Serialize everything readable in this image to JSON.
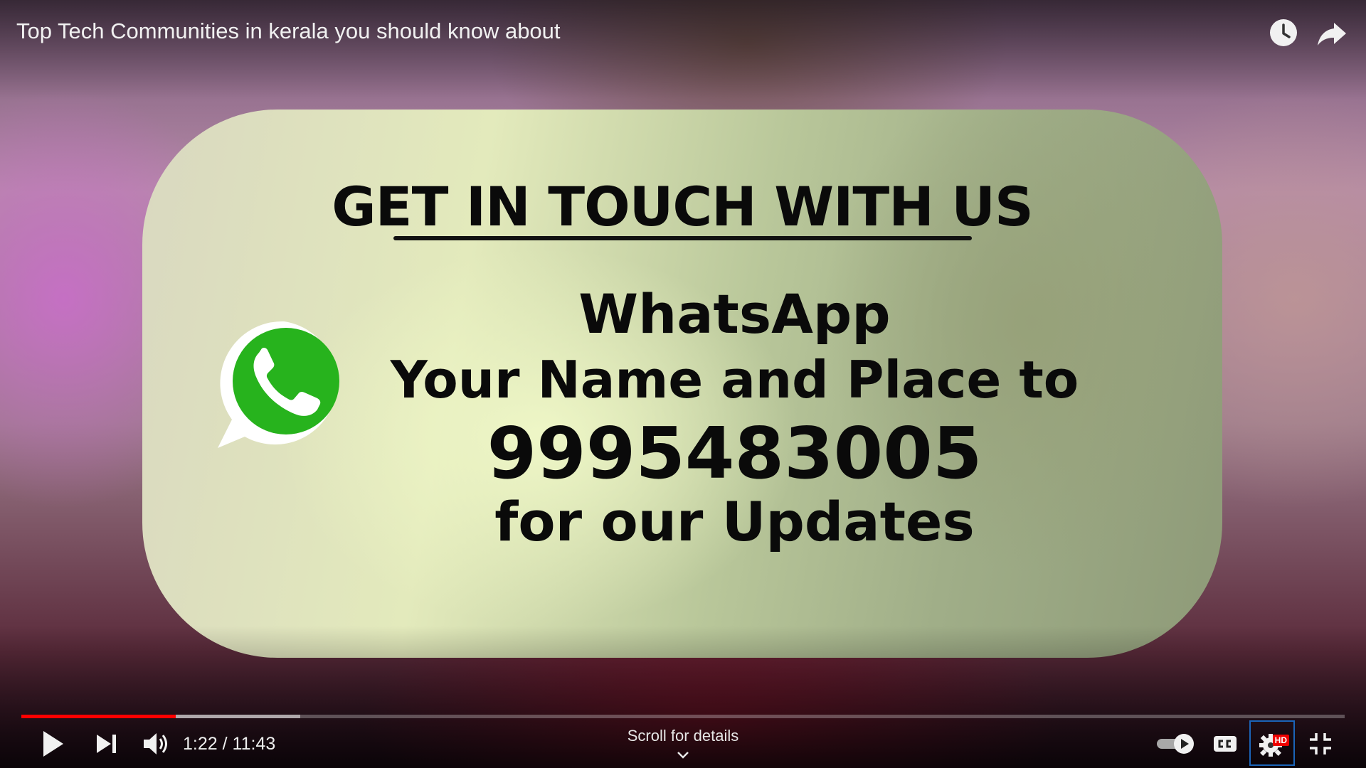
{
  "player": {
    "title": "Top Tech Communities in kerala you should know about",
    "time_current": "1:22",
    "time_separator": " / ",
    "time_total": "11:43",
    "played_fraction": 0.1165,
    "buffered_fraction": 0.2105,
    "scroll_hint": "Scroll for details",
    "hd_badge": "HD",
    "icons": {
      "watch_later": "clock-icon",
      "share": "share-arrow-icon",
      "play": "play-icon",
      "next": "next-icon",
      "volume": "volume-icon",
      "autoplay": "autoplay-toggle-icon",
      "captions": "captions-icon",
      "settings": "gear-icon",
      "exit_fullscreen": "exit-fullscreen-icon",
      "scroll": "chevron-down-icon"
    },
    "progress_color": "#ff0000"
  },
  "video_frame": {
    "heading": "GET IN TOUCH WITH US",
    "line1": "WhatsApp",
    "line2": "Your Name and Place to",
    "phone": "9995483005",
    "line4": "for our Updates",
    "logo": "whatsapp-logo",
    "logo_color": "#25b01c"
  }
}
